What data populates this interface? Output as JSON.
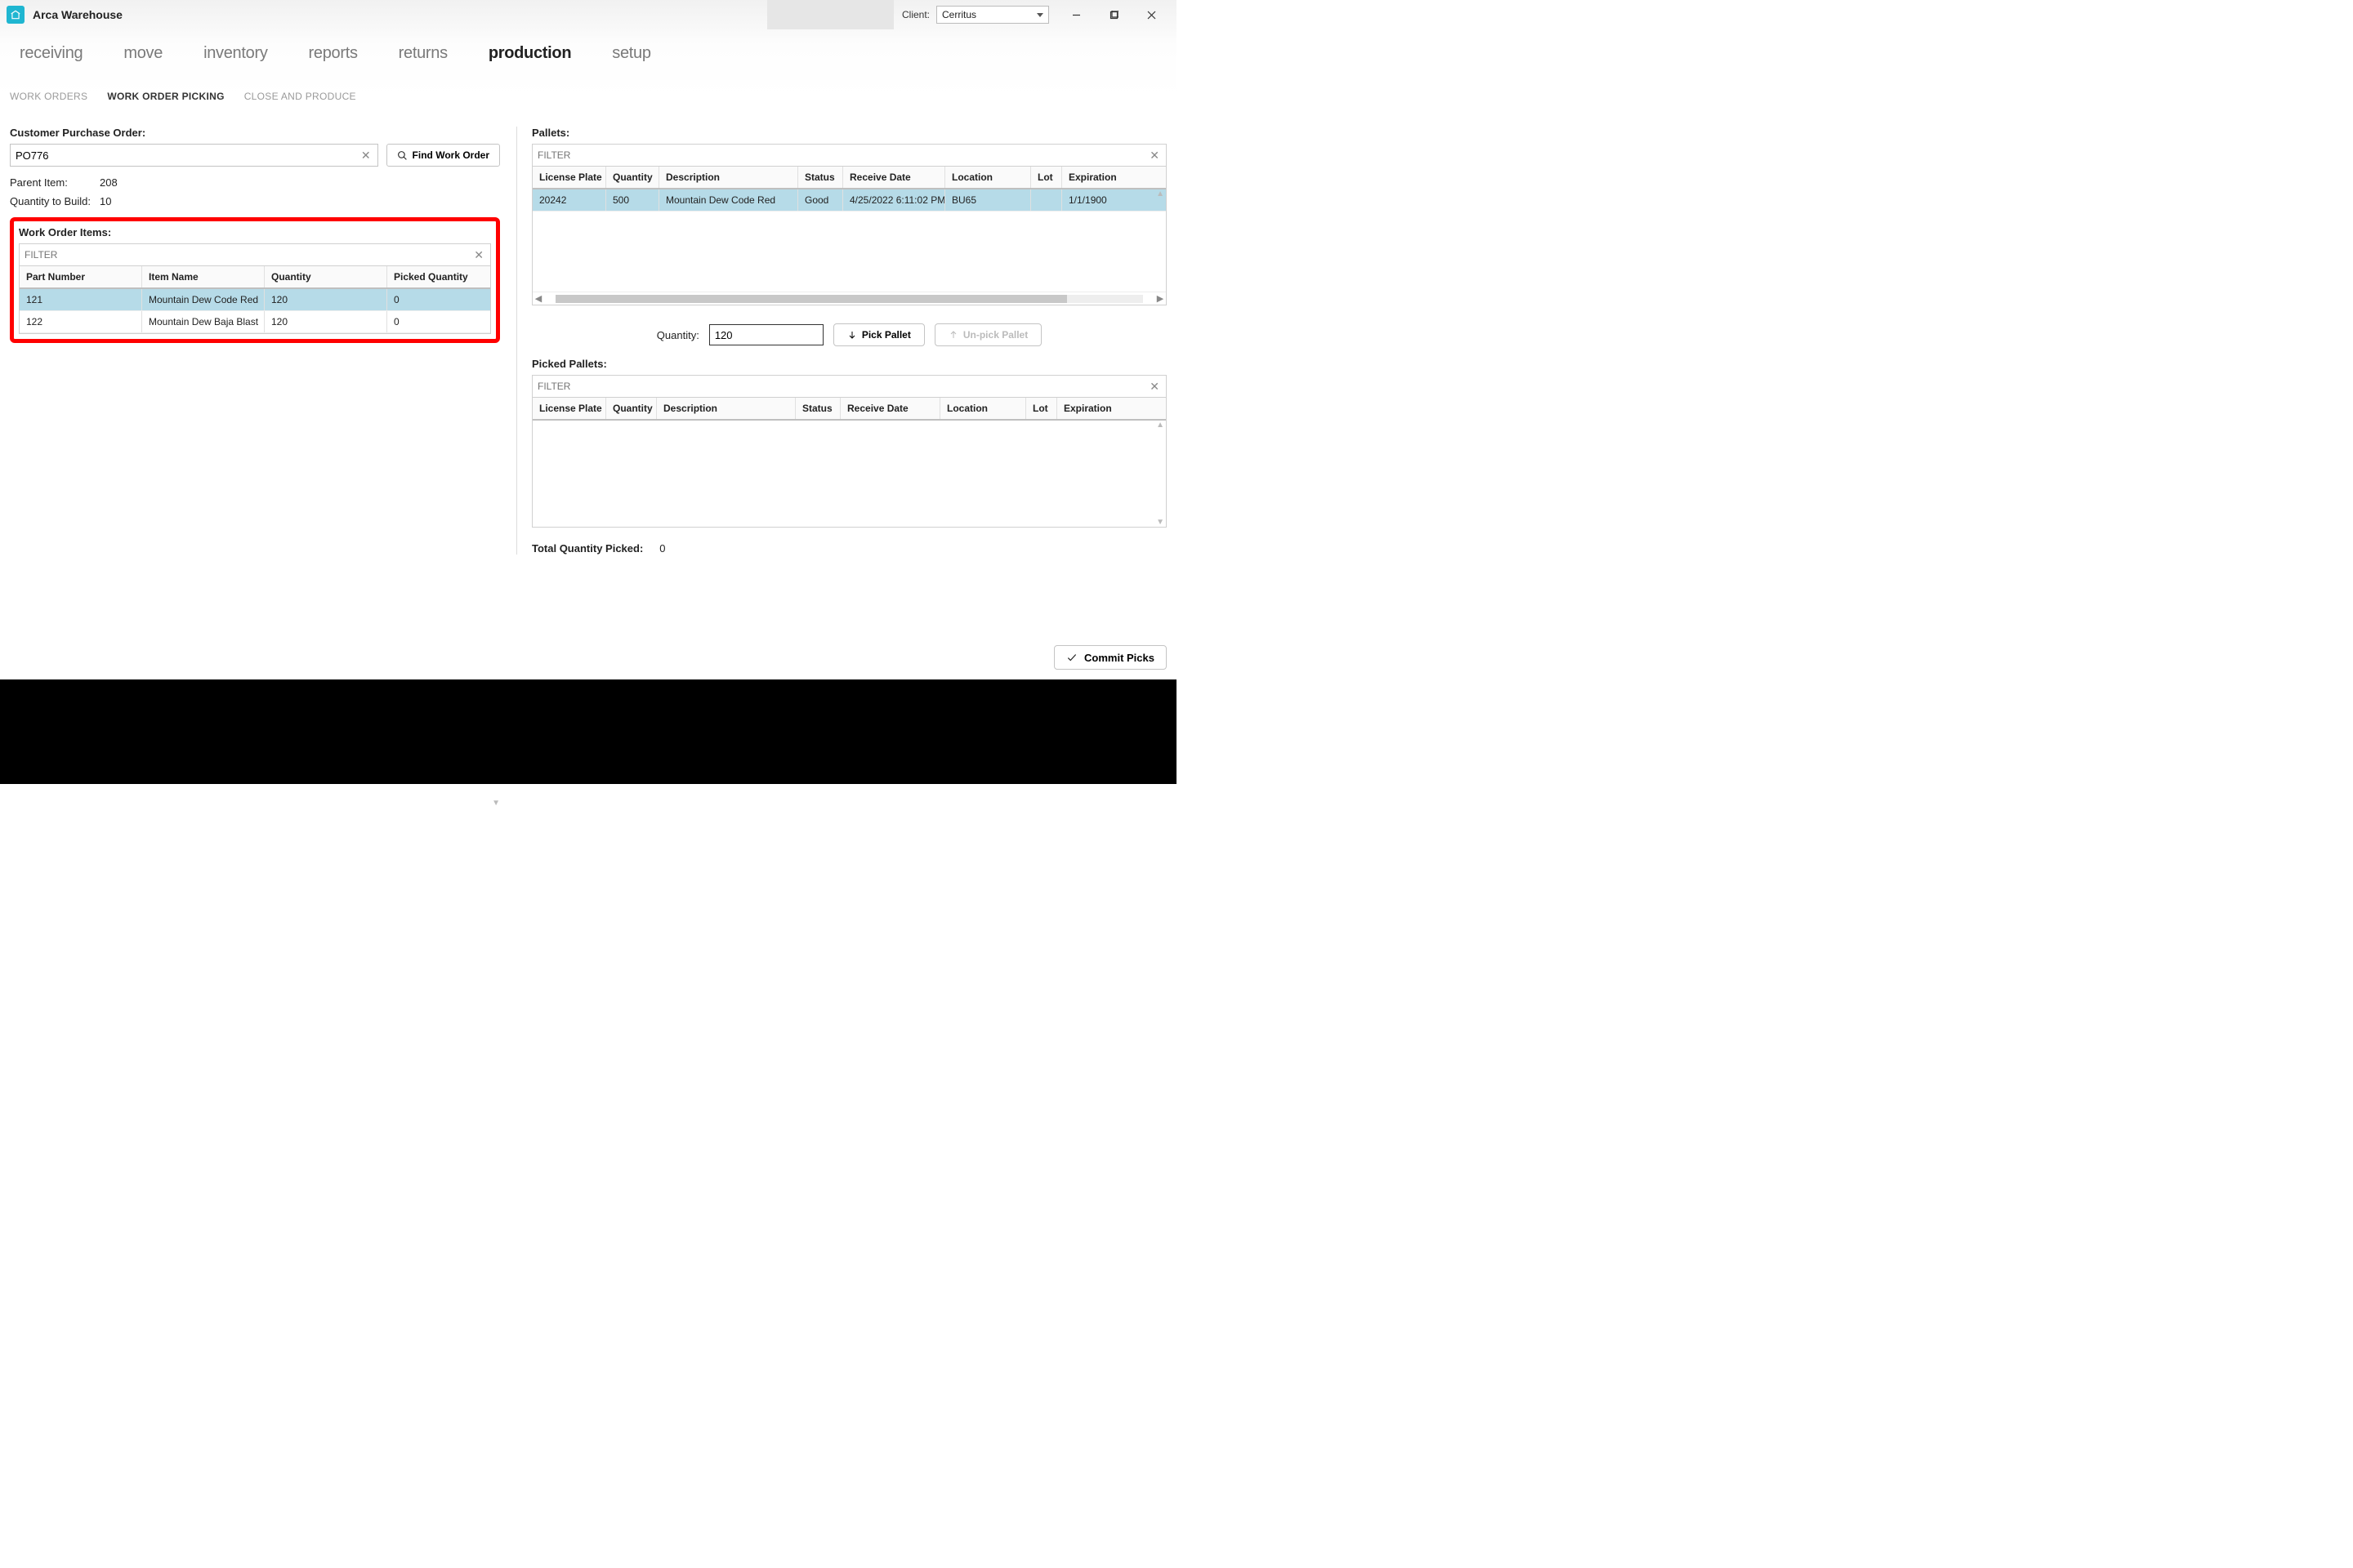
{
  "app": {
    "title": "Arca Warehouse"
  },
  "client": {
    "label": "Client:",
    "value": "Cerritus"
  },
  "nav": {
    "items": [
      "receiving",
      "move",
      "inventory",
      "reports",
      "returns",
      "production",
      "setup"
    ],
    "active_index": 5
  },
  "subnav": {
    "items": [
      "WORK ORDERS",
      "WORK ORDER PICKING",
      "CLOSE AND PRODUCE"
    ],
    "active_index": 1
  },
  "po": {
    "label": "Customer Purchase Order:",
    "value": "PO776",
    "find_label": "Find Work Order"
  },
  "details": {
    "parent_item_label": "Parent Item:",
    "parent_item_value": "208",
    "qty_build_label": "Quantity to Build:",
    "qty_build_value": "10"
  },
  "work_items": {
    "title": "Work Order Items:",
    "filter_placeholder": "FILTER",
    "columns": [
      "Part Number",
      "Item Name",
      "Quantity",
      "Picked Quantity"
    ],
    "rows": [
      {
        "part": "121",
        "name": "Mountain Dew Code Red",
        "qty": "120",
        "picked": "0",
        "selected": true
      },
      {
        "part": "122",
        "name": "Mountain Dew Baja Blast",
        "qty": "120",
        "picked": "0",
        "selected": false
      }
    ]
  },
  "pallets": {
    "title": "Pallets:",
    "filter_placeholder": "FILTER",
    "columns": [
      "License Plate",
      "Quantity",
      "Description",
      "Status",
      "Receive Date",
      "Location",
      "Lot",
      "Expiration"
    ],
    "rows": [
      {
        "lp": "20242",
        "qty": "500",
        "desc": "Mountain Dew Code Red",
        "status": "Good",
        "date": "4/25/2022 6:11:02 PM",
        "loc": "BU65",
        "lot": "",
        "exp": "1/1/1900",
        "selected": true
      }
    ]
  },
  "qty_input": {
    "label": "Quantity:",
    "value": "120",
    "pick_label": "Pick Pallet",
    "unpick_label": "Un-pick Pallet"
  },
  "picked": {
    "title": "Picked Pallets:",
    "filter_placeholder": "FILTER",
    "columns": [
      "License Plate",
      "Quantity",
      "Description",
      "Status",
      "Receive Date",
      "Location",
      "Lot",
      "Expiration"
    ],
    "rows": []
  },
  "total": {
    "label": "Total Quantity Picked:",
    "value": "0"
  },
  "commit_label": "Commit Picks"
}
